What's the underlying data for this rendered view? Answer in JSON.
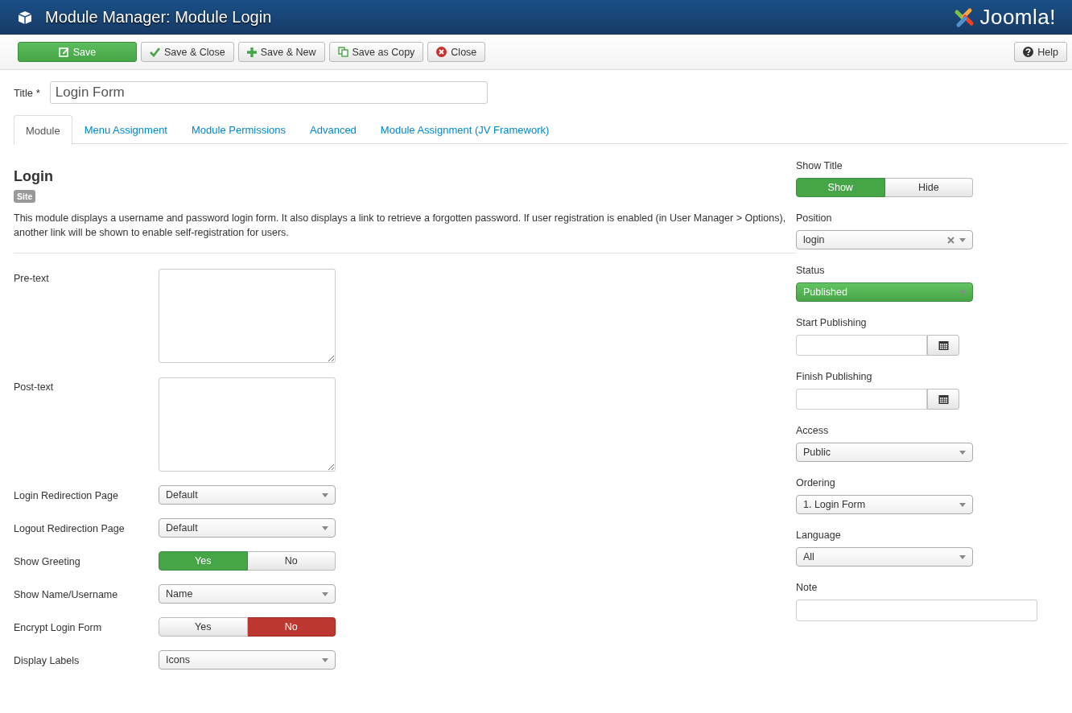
{
  "header": {
    "title": "Module Manager: Module Login",
    "logo_text": "Joomla!"
  },
  "toolbar": {
    "buttons": [
      {
        "label": "Save",
        "primary": true
      },
      {
        "label": "Save & Close",
        "primary": false
      },
      {
        "label": "Save & New",
        "primary": false
      },
      {
        "label": "Save as Copy",
        "primary": false
      },
      {
        "label": "Close",
        "primary": false
      }
    ],
    "help": "Help"
  },
  "title_field": {
    "label": "Title *",
    "value": "Login Form"
  },
  "tabs": [
    {
      "label": "Module",
      "selected": true
    },
    {
      "label": "Menu Assignment",
      "selected": false
    },
    {
      "label": "Module Permissions",
      "selected": false
    },
    {
      "label": "Advanced",
      "selected": false
    },
    {
      "label": "Module Assignment (JV Framework)",
      "selected": false
    }
  ],
  "module": {
    "heading": "Login",
    "badge": "Site",
    "description": "This module displays a username and password login form. It also displays a link to retrieve a forgotten password. If user registration is enabled (in User Manager > Options), another link will be shown to enable self-registration for users."
  },
  "fields": [
    {
      "kind": "textarea",
      "label": "Pre-text"
    },
    {
      "kind": "textarea",
      "label": "Post-text"
    },
    {
      "kind": "select",
      "label": "Login Redirection Page",
      "value": "Default"
    },
    {
      "kind": "select",
      "label": "Logout Redirection Page",
      "value": "Default"
    },
    {
      "kind": "toggle",
      "label": "Show Greeting",
      "options": [
        {
          "label": "Yes",
          "selected": true
        },
        {
          "label": "No",
          "selected": false
        }
      ]
    },
    {
      "kind": "select",
      "label": "Show Name/Username",
      "value": "Name"
    },
    {
      "kind": "toggle",
      "label": "Encrypt Login Form",
      "options": [
        {
          "label": "Yes",
          "selected": false
        },
        {
          "label": "No",
          "selected": true
        }
      ]
    },
    {
      "kind": "select",
      "label": "Display Labels",
      "value": "Icons"
    }
  ],
  "sidebar": [
    {
      "kind": "toggle",
      "label": "Show Title",
      "options": [
        {
          "label": "Show",
          "selected": true
        },
        {
          "label": "Hide",
          "selected": false
        }
      ]
    },
    {
      "kind": "clearable-select",
      "label": "Position",
      "value": "login"
    },
    {
      "kind": "status-select",
      "label": "Status",
      "value": "Published"
    },
    {
      "kind": "date",
      "label": "Start Publishing"
    },
    {
      "kind": "date",
      "label": "Finish Publishing"
    },
    {
      "kind": "select",
      "label": "Access",
      "value": "Public"
    },
    {
      "kind": "select",
      "label": "Ordering",
      "value": "1. Login Form"
    },
    {
      "kind": "select",
      "label": "Language",
      "value": "All"
    },
    {
      "kind": "text",
      "label": "Note"
    }
  ]
}
